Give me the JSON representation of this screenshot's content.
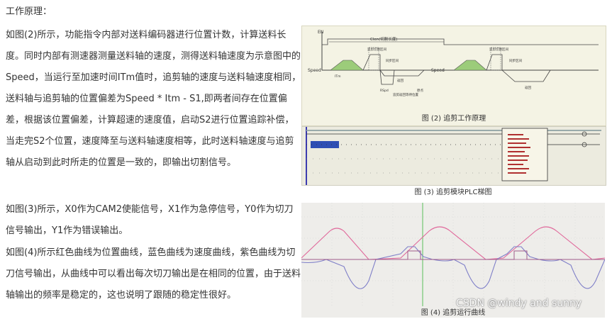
{
  "heading": "工作原理：",
  "paragraphs": [
    "如图(2)所示，功能指令内部对送料编码器进行位置计数，计算送料长度。同时内部有测速器测量送料轴的速度，测得送料轴速度为示意图中的Speed，当运行至加速时间ITm值时，追剪轴的速度与送料轴速度相同，送料轴与追剪轴的位置偏差为Speed * Itm - S1,即两者间存在位置偏差，根据该位置偏差，计算超速的速度值，启动S2进行位置追踪补偿，当走完S2个位置，速度降至与送料轴速度相等，此时送料轴速度与追剪轴从启动到此时所走的位置是一致的，即输出切割信号。",
    "如图(3)所示，X0作为CAM2使能信号，X1作为急停信号，Y0作为切刀信号输出，Y1作为错误输出。",
    "如图(4)所示红色曲线为位置曲线，蓝色曲线为速度曲线，紫色曲线为切刀信号输出，从曲线中可以看出每次切刀输出是在相同的位置，由于送料轴输出的频率是稳定的，这也说明了跟随的稳定性很好。"
  ],
  "figures": {
    "fig2": {
      "caption": "图 (2) 追剪工作原理",
      "labels": {
        "en": "EN",
        "speed": "Speed",
        "itm": "ITm",
        "clen": "Clen(切割长度)",
        "cut_signal": "追剪切割区间",
        "sync": "同步区间",
        "return": "返回",
        "rspd": "RSpd",
        "return_origin": "追剪返回等待位置",
        "origin": "原点"
      }
    },
    "fig3": {
      "caption": "图 (3) 追剪模块PLC梯图"
    },
    "fig4": {
      "caption": "图 (4) 追剪运行曲线"
    }
  },
  "watermark": "CSDN @windy and sunny",
  "colors": {
    "position_curve": "#e0679a",
    "speed_curve": "#7f7fc8",
    "cut_signal_curve": "#a05a8a",
    "sync_fill": "#9ccc7a"
  }
}
